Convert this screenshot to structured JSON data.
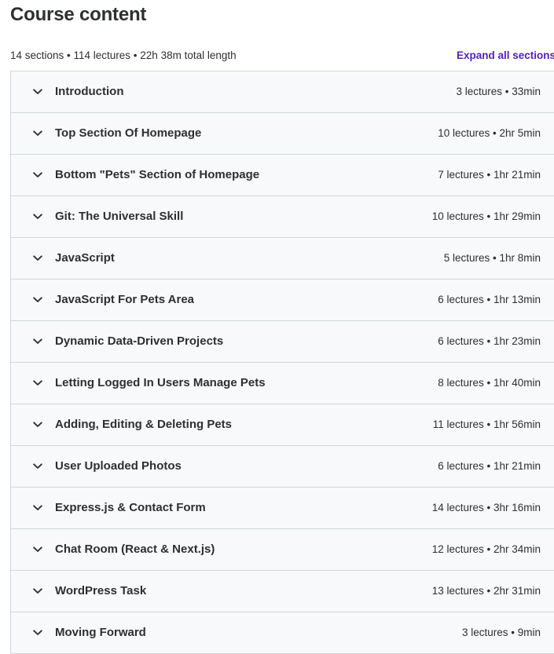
{
  "header": {
    "title": "Course content"
  },
  "summary": {
    "text": "14 sections • 114 lectures • 22h 38m total length",
    "expand_label": "Expand all sections"
  },
  "icons": {
    "chevron": "chevron-down-icon"
  },
  "sections": [
    {
      "title": "Introduction",
      "meta": "3 lectures • 33min"
    },
    {
      "title": "Top Section Of Homepage",
      "meta": "10 lectures • 2hr 5min"
    },
    {
      "title": "Bottom \"Pets\" Section of Homepage",
      "meta": "7 lectures • 1hr 21min"
    },
    {
      "title": "Git: The Universal Skill",
      "meta": "10 lectures • 1hr 29min"
    },
    {
      "title": "JavaScript",
      "meta": "5 lectures • 1hr 8min"
    },
    {
      "title": "JavaScript For Pets Area",
      "meta": "6 lectures • 1hr 13min"
    },
    {
      "title": "Dynamic Data-Driven Projects",
      "meta": "6 lectures • 1hr 23min"
    },
    {
      "title": "Letting Logged In Users Manage Pets",
      "meta": "8 lectures • 1hr 40min"
    },
    {
      "title": "Adding, Editing & Deleting Pets",
      "meta": "11 lectures • 1hr 56min"
    },
    {
      "title": "User Uploaded Photos",
      "meta": "6 lectures • 1hr 21min"
    },
    {
      "title": "Express.js & Contact Form",
      "meta": "14 lectures • 3hr 16min"
    },
    {
      "title": "Chat Room (React & Next.js)",
      "meta": "12 lectures • 2hr 34min"
    },
    {
      "title": "WordPress Task",
      "meta": "13 lectures • 2hr 31min"
    },
    {
      "title": "Moving Forward",
      "meta": "3 lectures • 9min"
    }
  ]
}
